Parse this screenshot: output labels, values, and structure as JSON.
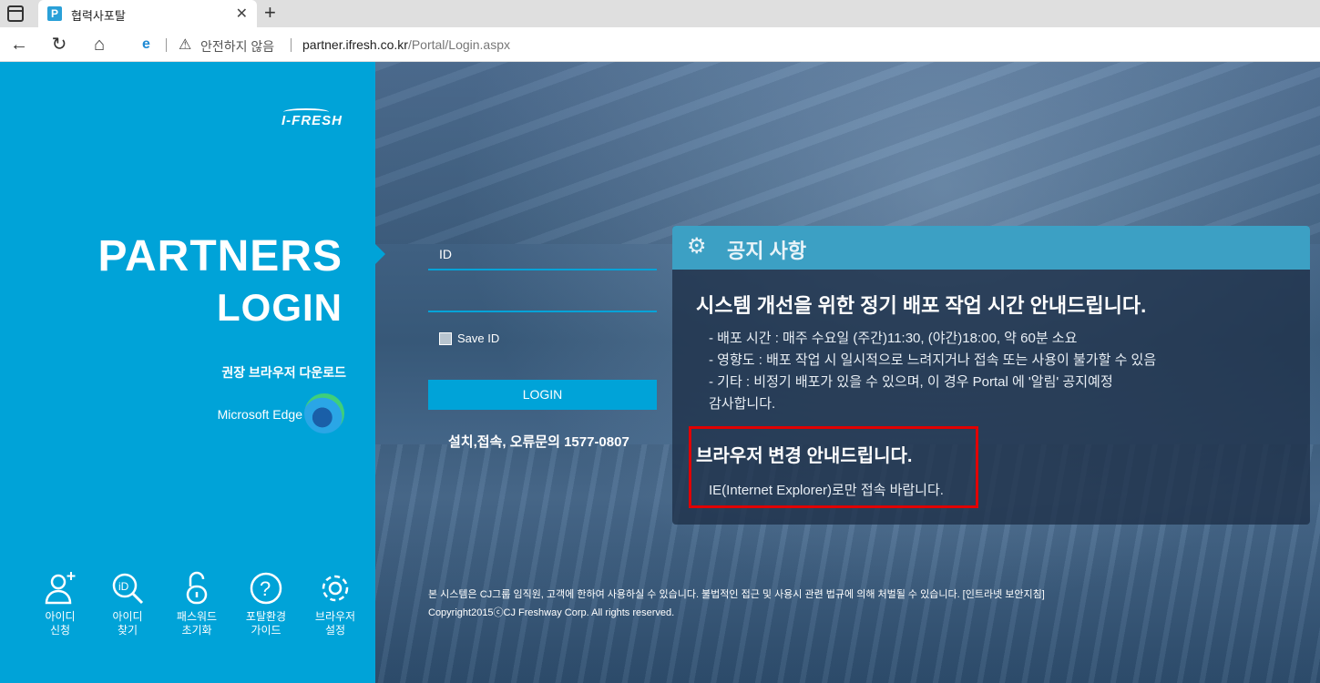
{
  "browser": {
    "tab_title": "협력사포탈",
    "tab_favicon": "P",
    "security_label": "안전하지 않음",
    "url_host": "partner.ifresh.co.kr",
    "url_path": "/Portal/Login.aspx"
  },
  "brand": {
    "logo": "I-FRESH",
    "title_line1": "PARTNERS",
    "title_line2": "LOGIN",
    "recommended_browser": "권장 브라우저 다운로드",
    "edge_label": "Microsoft Edge",
    "colors": {
      "primary": "#00a3d8",
      "notice_head": "#3ca0c4",
      "highlight": "#e10000"
    }
  },
  "quick_links": [
    {
      "icon": "user-add-icon",
      "label": "아이디\n신청"
    },
    {
      "icon": "id-search-icon",
      "label": "아이디\n찾기"
    },
    {
      "icon": "lock-icon",
      "label": "패스워드\n초기화"
    },
    {
      "icon": "help-icon",
      "label": "포탈환경\n가이드"
    },
    {
      "icon": "gear-icon",
      "label": "브라우저\n설정"
    }
  ],
  "login": {
    "id_label": "ID",
    "save_id_label": "Save ID",
    "login_button": "LOGIN",
    "support": "설치,접속, 오류문의 1577-0807"
  },
  "notice": {
    "title": "공지 사항",
    "heading1": "시스템 개선을 위한 정기 배포 작업 시간 안내드립니다.",
    "lines": [
      "- 배포 시간 : 매주 수요일 (주간)11:30, (야간)18:00, 약 60분 소요",
      "- 영향도 : 배포 작업 시 일시적으로 느려지거나 접속 또는 사용이 불가할 수 있음",
      "- 기타 : 비정기 배포가 있을 수 있으며, 이 경우 Portal 에 '알림' 공지예정",
      "감사합니다."
    ],
    "heading2": "브라우저 변경 안내드립니다.",
    "line2": "IE(Internet Explorer)로만 접속 바랍니다."
  },
  "footer": {
    "line1": "본 시스템은 CJ그룹 임직원, 고객에 한하여 사용하실 수 있습니다. 불법적인 접근 및 사용시 관련 법규에 의해 처벌될 수 있습니다. [인트라넷 보안지침]",
    "line2": "Copyright2015ⓒCJ Freshway Corp. All rights reserved."
  }
}
